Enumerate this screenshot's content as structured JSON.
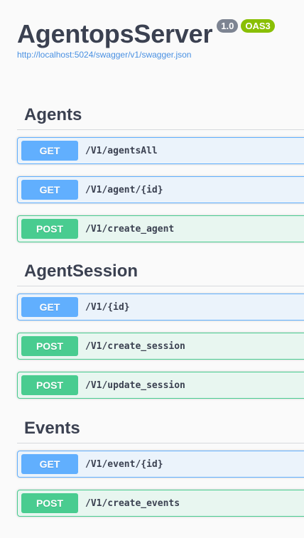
{
  "info": {
    "title": "AgentopsServer",
    "version": "1.0",
    "oas": "OAS3",
    "spec_url": "http://localhost:5024/swagger/v1/swagger.json"
  },
  "tags": [
    {
      "name": "Agents",
      "operations": [
        {
          "method": "GET",
          "path": "/V1/agentsAll"
        },
        {
          "method": "GET",
          "path": "/V1/agent/{id}"
        },
        {
          "method": "POST",
          "path": "/V1/create_agent"
        }
      ]
    },
    {
      "name": "AgentSession",
      "operations": [
        {
          "method": "GET",
          "path": "/V1/{id}"
        },
        {
          "method": "POST",
          "path": "/V1/create_session"
        },
        {
          "method": "POST",
          "path": "/V1/update_session"
        }
      ]
    },
    {
      "name": "Events",
      "operations": [
        {
          "method": "GET",
          "path": "/V1/event/{id}"
        },
        {
          "method": "POST",
          "path": "/V1/create_events"
        }
      ]
    }
  ],
  "colors": {
    "get": "#61affe",
    "post": "#49cc90",
    "version_badge": "#7d8492",
    "oas_badge": "#89bf04",
    "link": "#4990e2"
  }
}
